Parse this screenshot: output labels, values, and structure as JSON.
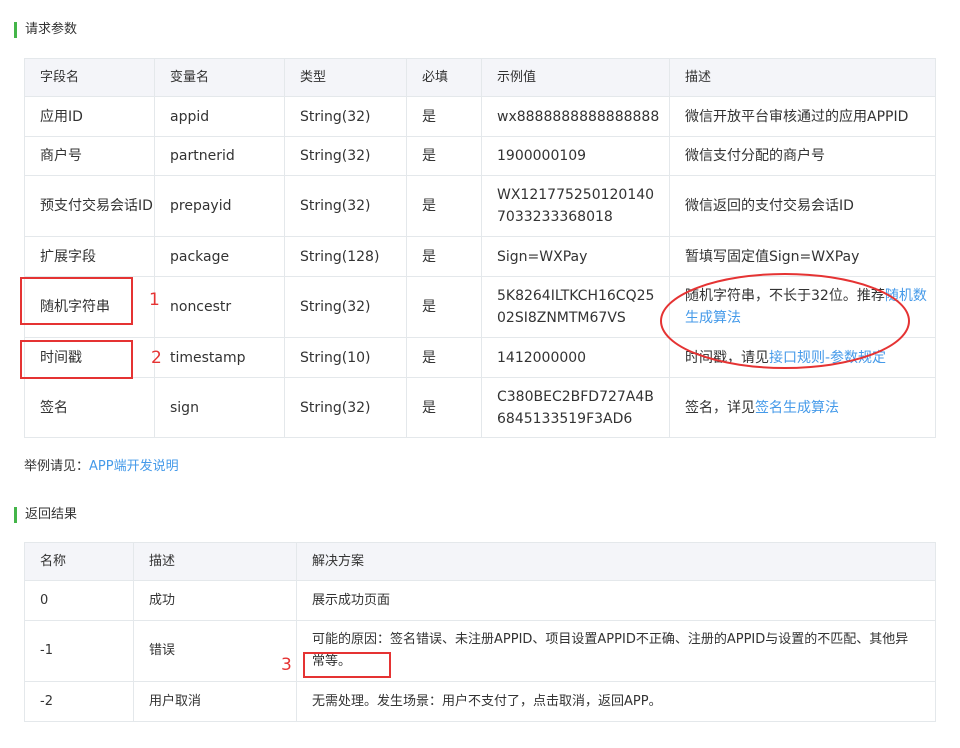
{
  "request_section": {
    "title": "请求参数"
  },
  "params_table": {
    "headers": [
      "字段名",
      "变量名",
      "类型",
      "必填",
      "示例值",
      "描述"
    ],
    "rows": [
      {
        "field": "应用ID",
        "var": "appid",
        "type": "String(32)",
        "required": "是",
        "example": "wx8888888888888888",
        "desc": "微信开放平台审核通过的应用APPID"
      },
      {
        "field": "商户号",
        "var": "partnerid",
        "type": "String(32)",
        "required": "是",
        "example": "1900000109",
        "desc": "微信支付分配的商户号"
      },
      {
        "field": "预支付交易会话ID",
        "var": "prepayid",
        "type": "String(32)",
        "required": "是",
        "example": "WX1217752501201407033233368018",
        "desc": "微信返回的支付交易会话ID"
      },
      {
        "field": "扩展字段",
        "var": "package",
        "type": "String(128)",
        "required": "是",
        "example": "Sign=WXPay",
        "desc": "暂填写固定值Sign=WXPay"
      },
      {
        "field": "随机字符串",
        "var": "noncestr",
        "type": "String(32)",
        "required": "是",
        "example": "5K8264ILTKCH16CQ2502SI8ZNMTM67VS",
        "desc_prefix": "随机字符串，不长于32位。推荐",
        "desc_link": "随机数生成算法"
      },
      {
        "field": "时间戳",
        "var": "timestamp",
        "type": "String(10)",
        "required": "是",
        "example": "1412000000",
        "desc_prefix": "时间戳，请见",
        "desc_link": "接口规则-参数规定"
      },
      {
        "field": "签名",
        "var": "sign",
        "type": "String(32)",
        "required": "是",
        "example": "C380BEC2BFD727A4B6845133519F3AD6",
        "desc_prefix": "签名，详见",
        "desc_link": "签名生成算法"
      }
    ]
  },
  "example_note": {
    "prefix": "举例请见：",
    "link": "APP端开发说明"
  },
  "result_section": {
    "title": "返回结果"
  },
  "results_table": {
    "headers": [
      "名称",
      "描述",
      "解决方案"
    ],
    "rows": [
      {
        "code": "0",
        "desc": "成功",
        "solution": "展示成功页面"
      },
      {
        "code": "-1",
        "desc": "错误",
        "solution": "可能的原因：签名错误、未注册APPID、项目设置APPID不正确、注册的APPID与设置的不匹配、其他异常等。"
      },
      {
        "code": "-2",
        "desc": "用户取消",
        "solution": "无需处理。发生场景：用户不支付了，点击取消，返回APP。"
      }
    ]
  },
  "annotations": {
    "num1": "1",
    "num2": "2",
    "num3": "3"
  },
  "colors": {
    "accent": "#44b549",
    "link": "#459ae9",
    "annotation": "#e53333",
    "header_bg": "#f4f5f9",
    "border": "#e4e8eb"
  }
}
